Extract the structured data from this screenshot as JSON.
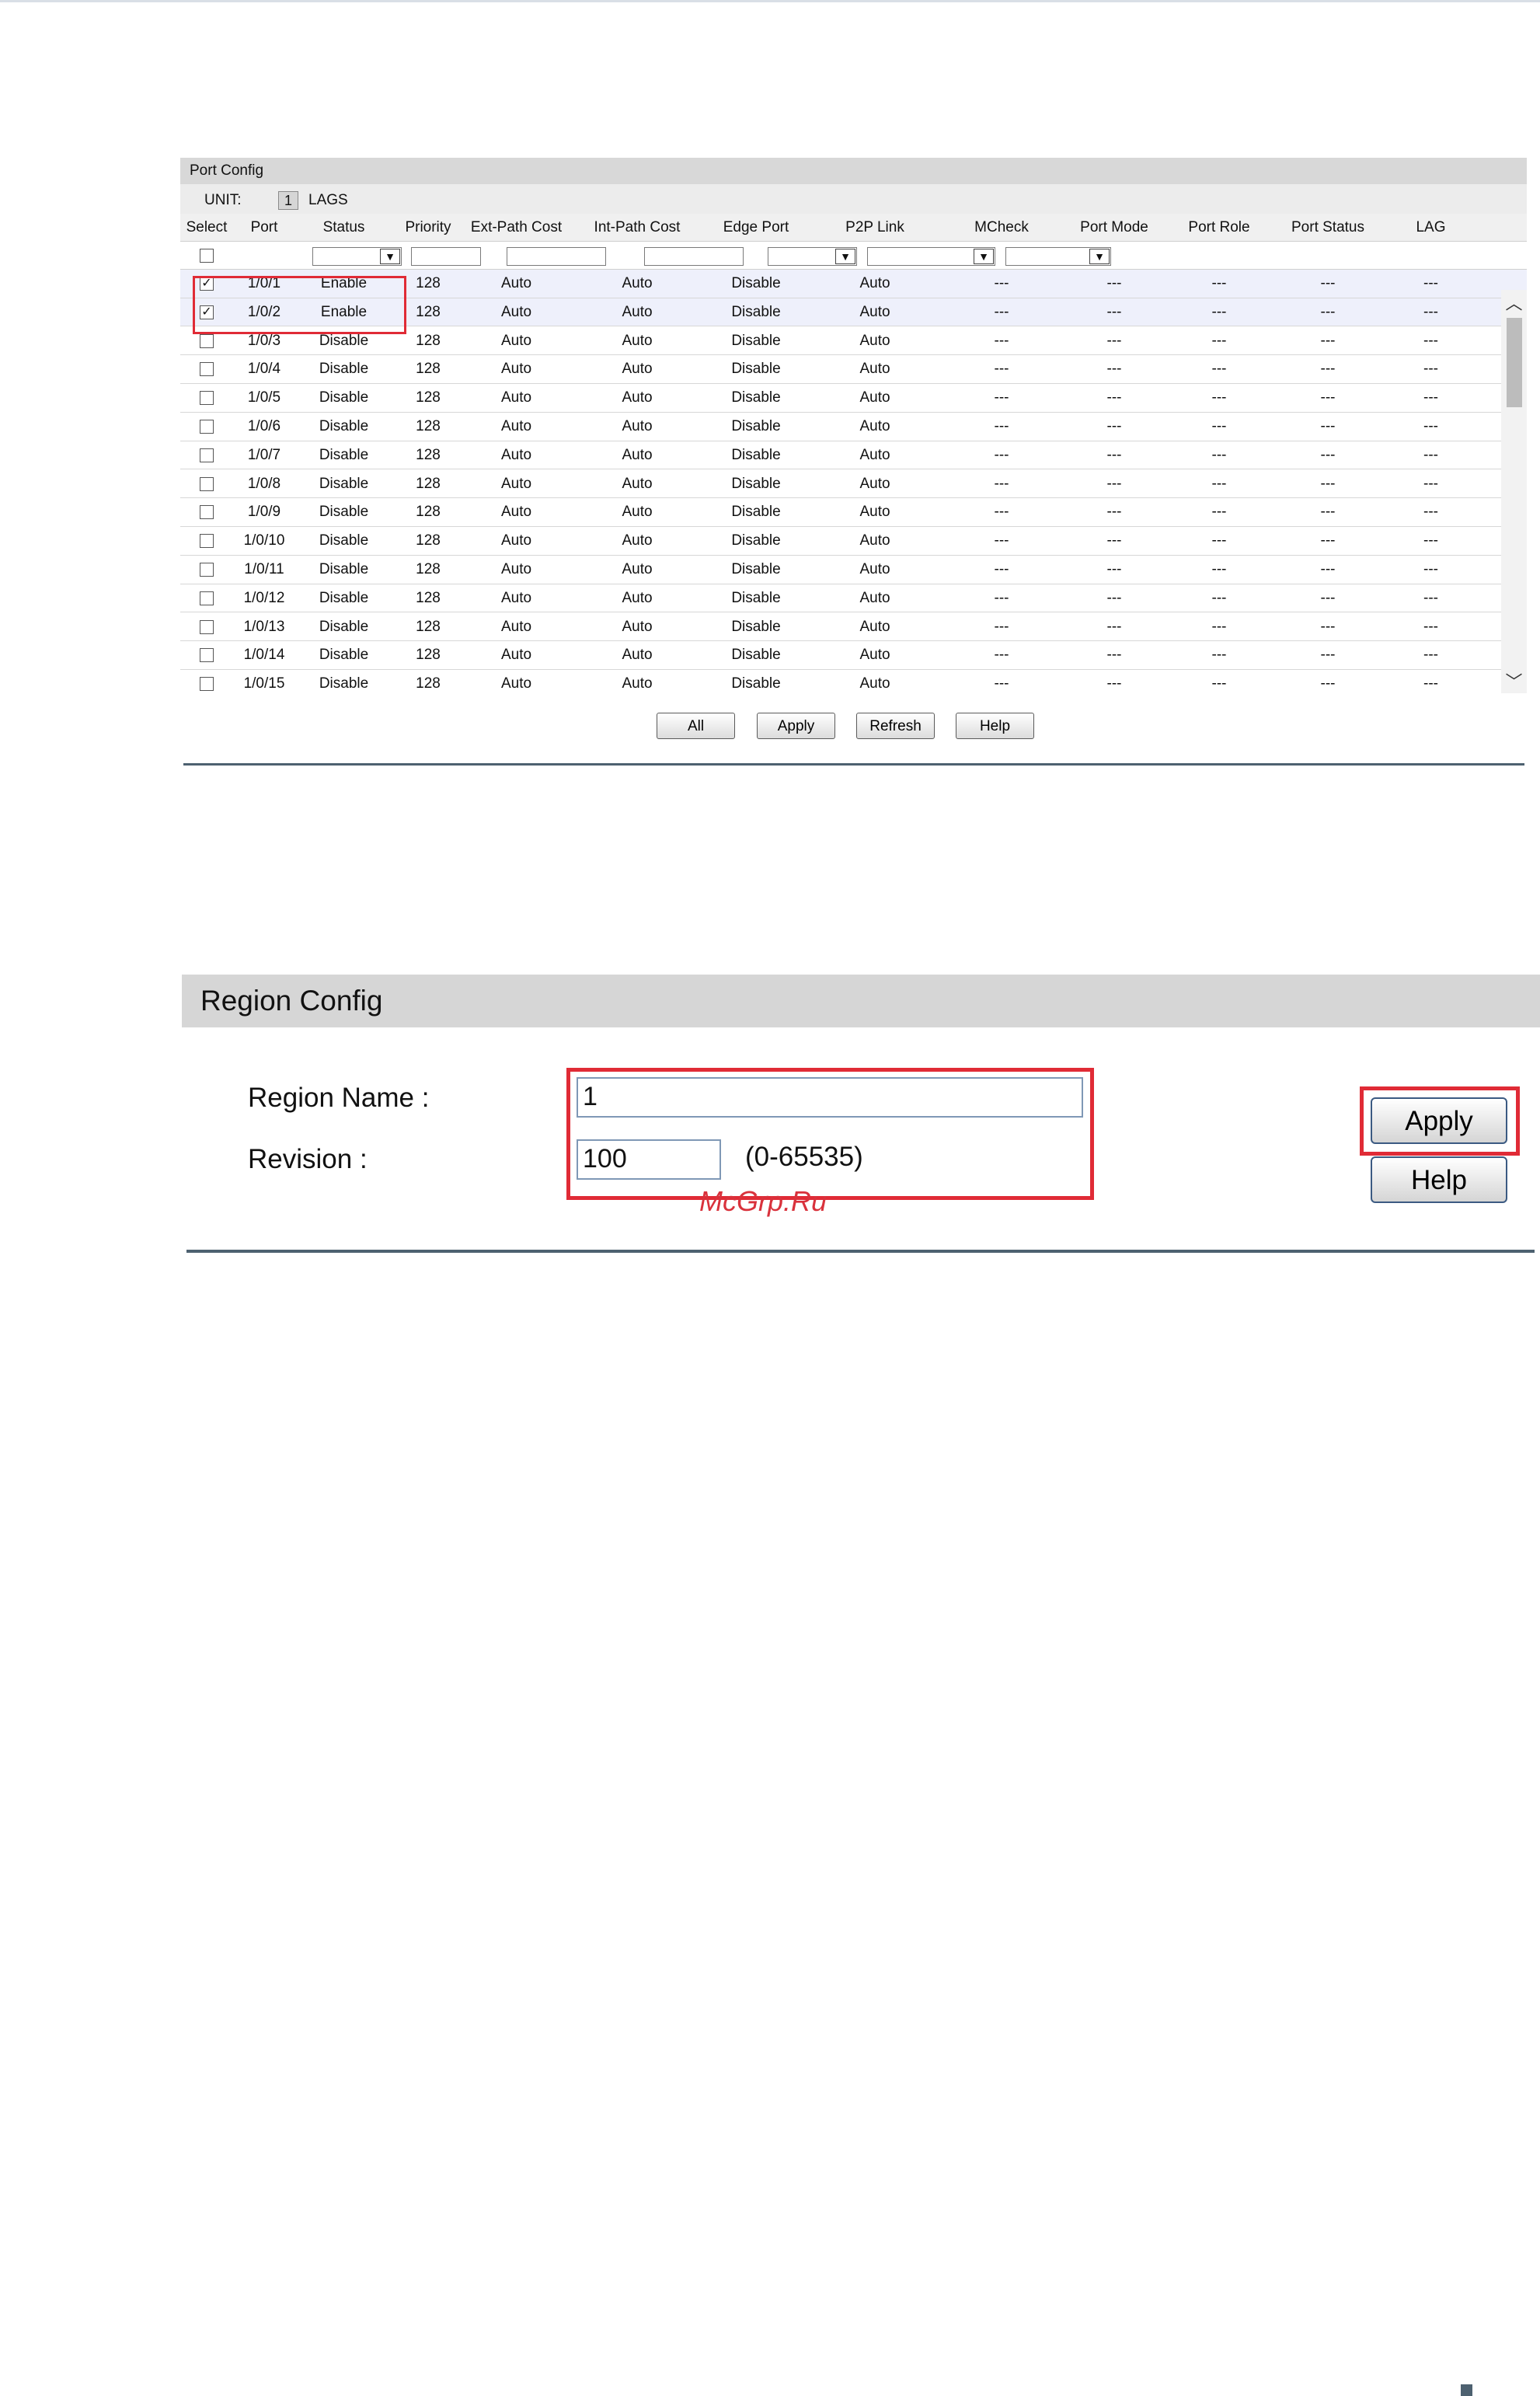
{
  "port_config": {
    "title": "Port Config",
    "unit_label": "UNIT:",
    "unit_value": "1",
    "lags_label": "LAGS",
    "columns": [
      "Select",
      "Port",
      "Status",
      "Priority",
      "Ext-Path Cost",
      "Int-Path Cost",
      "Edge Port",
      "P2P Link",
      "MCheck",
      "Port Mode",
      "Port Role",
      "Port Status",
      "LAG"
    ],
    "rows": [
      {
        "checked": true,
        "port": "1/0/1",
        "status": "Enable",
        "priority": "128",
        "ext": "Auto",
        "int": "Auto",
        "edge": "Disable",
        "p2p": "Auto",
        "mcheck": "---",
        "mode": "---",
        "role": "---",
        "pstatus": "---",
        "lag": "---"
      },
      {
        "checked": true,
        "port": "1/0/2",
        "status": "Enable",
        "priority": "128",
        "ext": "Auto",
        "int": "Auto",
        "edge": "Disable",
        "p2p": "Auto",
        "mcheck": "---",
        "mode": "---",
        "role": "---",
        "pstatus": "---",
        "lag": "---"
      },
      {
        "checked": false,
        "port": "1/0/3",
        "status": "Disable",
        "priority": "128",
        "ext": "Auto",
        "int": "Auto",
        "edge": "Disable",
        "p2p": "Auto",
        "mcheck": "---",
        "mode": "---",
        "role": "---",
        "pstatus": "---",
        "lag": "---"
      },
      {
        "checked": false,
        "port": "1/0/4",
        "status": "Disable",
        "priority": "128",
        "ext": "Auto",
        "int": "Auto",
        "edge": "Disable",
        "p2p": "Auto",
        "mcheck": "---",
        "mode": "---",
        "role": "---",
        "pstatus": "---",
        "lag": "---"
      },
      {
        "checked": false,
        "port": "1/0/5",
        "status": "Disable",
        "priority": "128",
        "ext": "Auto",
        "int": "Auto",
        "edge": "Disable",
        "p2p": "Auto",
        "mcheck": "---",
        "mode": "---",
        "role": "---",
        "pstatus": "---",
        "lag": "---"
      },
      {
        "checked": false,
        "port": "1/0/6",
        "status": "Disable",
        "priority": "128",
        "ext": "Auto",
        "int": "Auto",
        "edge": "Disable",
        "p2p": "Auto",
        "mcheck": "---",
        "mode": "---",
        "role": "---",
        "pstatus": "---",
        "lag": "---"
      },
      {
        "checked": false,
        "port": "1/0/7",
        "status": "Disable",
        "priority": "128",
        "ext": "Auto",
        "int": "Auto",
        "edge": "Disable",
        "p2p": "Auto",
        "mcheck": "---",
        "mode": "---",
        "role": "---",
        "pstatus": "---",
        "lag": "---"
      },
      {
        "checked": false,
        "port": "1/0/8",
        "status": "Disable",
        "priority": "128",
        "ext": "Auto",
        "int": "Auto",
        "edge": "Disable",
        "p2p": "Auto",
        "mcheck": "---",
        "mode": "---",
        "role": "---",
        "pstatus": "---",
        "lag": "---"
      },
      {
        "checked": false,
        "port": "1/0/9",
        "status": "Disable",
        "priority": "128",
        "ext": "Auto",
        "int": "Auto",
        "edge": "Disable",
        "p2p": "Auto",
        "mcheck": "---",
        "mode": "---",
        "role": "---",
        "pstatus": "---",
        "lag": "---"
      },
      {
        "checked": false,
        "port": "1/0/10",
        "status": "Disable",
        "priority": "128",
        "ext": "Auto",
        "int": "Auto",
        "edge": "Disable",
        "p2p": "Auto",
        "mcheck": "---",
        "mode": "---",
        "role": "---",
        "pstatus": "---",
        "lag": "---"
      },
      {
        "checked": false,
        "port": "1/0/11",
        "status": "Disable",
        "priority": "128",
        "ext": "Auto",
        "int": "Auto",
        "edge": "Disable",
        "p2p": "Auto",
        "mcheck": "---",
        "mode": "---",
        "role": "---",
        "pstatus": "---",
        "lag": "---"
      },
      {
        "checked": false,
        "port": "1/0/12",
        "status": "Disable",
        "priority": "128",
        "ext": "Auto",
        "int": "Auto",
        "edge": "Disable",
        "p2p": "Auto",
        "mcheck": "---",
        "mode": "---",
        "role": "---",
        "pstatus": "---",
        "lag": "---"
      },
      {
        "checked": false,
        "port": "1/0/13",
        "status": "Disable",
        "priority": "128",
        "ext": "Auto",
        "int": "Auto",
        "edge": "Disable",
        "p2p": "Auto",
        "mcheck": "---",
        "mode": "---",
        "role": "---",
        "pstatus": "---",
        "lag": "---"
      },
      {
        "checked": false,
        "port": "1/0/14",
        "status": "Disable",
        "priority": "128",
        "ext": "Auto",
        "int": "Auto",
        "edge": "Disable",
        "p2p": "Auto",
        "mcheck": "---",
        "mode": "---",
        "role": "---",
        "pstatus": "---",
        "lag": "---"
      },
      {
        "checked": false,
        "port": "1/0/15",
        "status": "Disable",
        "priority": "128",
        "ext": "Auto",
        "int": "Auto",
        "edge": "Disable",
        "p2p": "Auto",
        "mcheck": "---",
        "mode": "---",
        "role": "---",
        "pstatus": "---",
        "lag": "---"
      }
    ],
    "buttons": {
      "all": "All",
      "apply": "Apply",
      "refresh": "Refresh",
      "help": "Help"
    },
    "icons": {
      "scroll_up": "chevron-up-icon",
      "scroll_down": "chevron-down-icon",
      "dropdown": "chevron-down-icon"
    }
  },
  "region_config": {
    "title": "Region Config",
    "region_name_label": "Region Name :",
    "region_name_value": "1",
    "revision_label": "Revision :",
    "revision_value": "100",
    "revision_range": "(0-65535)",
    "apply_label": "Apply",
    "help_label": "Help"
  },
  "watermark": "McGrp.Ru",
  "colors": {
    "highlight_red": "#e02b36",
    "separator": "#4d6170",
    "selected_row": "#eef0fb"
  }
}
